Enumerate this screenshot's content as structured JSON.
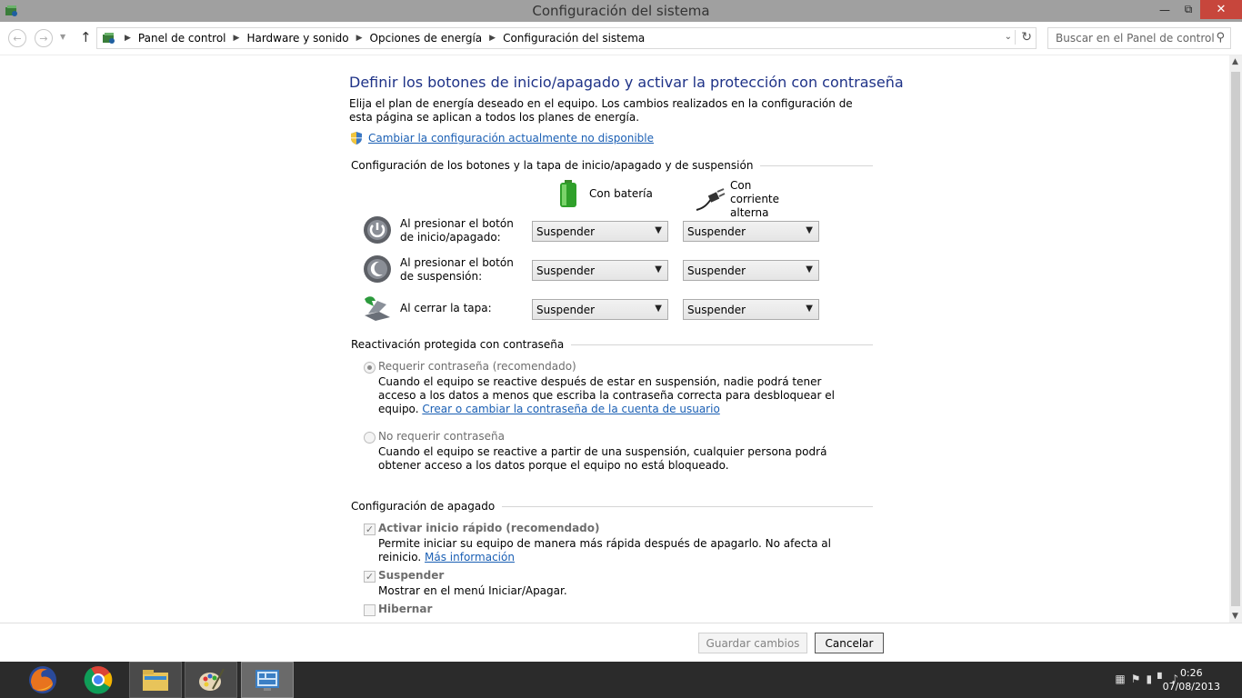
{
  "window": {
    "title": "Configuración del sistema"
  },
  "address": {
    "breadcrumbs": [
      "Panel de control",
      "Hardware y sonido",
      "Opciones de energía",
      "Configuración del sistema"
    ],
    "search_placeholder": "Buscar en el Panel de control"
  },
  "main": {
    "heading": "Definir los botones de inicio/apagado y activar la protección con contraseña",
    "intro": "Elija el plan de energía deseado en el equipo. Los cambios realizados en la configuración de esta página se aplican a todos los planes de energía.",
    "change_link": "Cambiar la configuración actualmente no disponible",
    "buttons_section": "Configuración de los botones y la tapa de inicio/apagado y de suspensión",
    "col_battery": "Con batería",
    "col_ac": "Con corriente alterna",
    "rows": [
      {
        "label": "Al presionar el botón de inicio/apagado:",
        "battery": "Suspender",
        "ac": "Suspender"
      },
      {
        "label": "Al presionar el botón de suspensión:",
        "battery": "Suspender",
        "ac": "Suspender"
      },
      {
        "label": "Al cerrar la tapa:",
        "battery": "Suspender",
        "ac": "Suspender"
      }
    ],
    "password_section": "Reactivación protegida con contraseña",
    "require_label": "Requerir contraseña (recomendado)",
    "require_desc": "Cuando el equipo se reactive después de estar en suspensión, nadie podrá tener acceso a los datos a menos que escriba la contraseña correcta para desbloquear el equipo.",
    "require_link": "Crear o cambiar la contraseña de la cuenta de usuario",
    "norequire_label": "No requerir contraseña",
    "norequire_desc": "Cuando el equipo se reactive a partir de una suspensión, cualquier persona podrá obtener acceso a los datos porque el equipo no está bloqueado.",
    "shutdown_section": "Configuración de apagado",
    "fast_label": "Activar inicio rápido (recomendado)",
    "fast_desc": "Permite iniciar su equipo de manera más rápida después de apagarlo. No afecta al reinicio.",
    "fast_link": "Más información",
    "sleep_label": "Suspender",
    "sleep_desc": "Mostrar en el menú Iniciar/Apagar.",
    "hibernate_label": "Hibernar"
  },
  "footer": {
    "save": "Guardar cambios",
    "cancel": "Cancelar"
  },
  "taskbar": {
    "time": "0:26",
    "date": "07/08/2013"
  }
}
